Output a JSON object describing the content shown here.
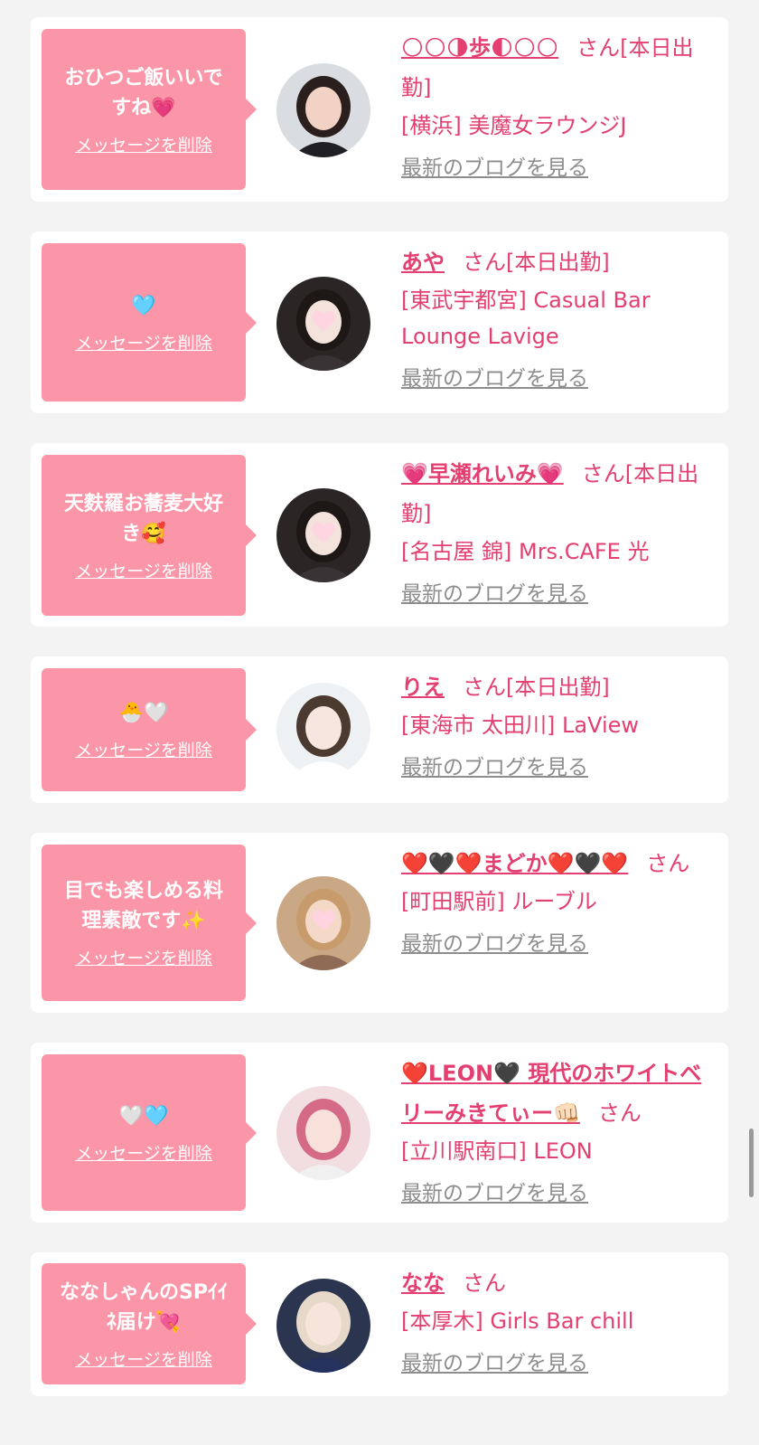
{
  "delete_label": "メッセージを削除",
  "blog_label": "最新のブログを見る",
  "colors": {
    "accent": "#e33f70",
    "bubble": "#fb96a8",
    "background": "#f3f3f3",
    "card": "#ffffff",
    "link_gray": "#8d8d8d"
  },
  "entries": [
    {
      "message": "おひつご飯いいで\nすね💗",
      "name": "🌕🌕🌗歩🌓🌕🌕",
      "suffix": "さん[本日出勤]",
      "shop": "[横浜] 美魔女ラウンジJ",
      "avatar_icon": "avatar-photo-suit"
    },
    {
      "message": "🩵",
      "name": "あや",
      "suffix": "さん[本日出勤]",
      "shop": "[東武宇都宮] Casual Bar Lounge Lavige",
      "avatar_icon": "avatar-photo-heart"
    },
    {
      "message": "天麩羅お蕎麦大好\nき🥰",
      "name": "💗早瀬れいみ💗",
      "suffix": "さん[本日出勤]",
      "shop": "[名古屋 錦] Mrs.CAFE 光",
      "avatar_icon": "avatar-photo-heart"
    },
    {
      "message": "🐣🤍",
      "name": "りえ",
      "suffix": "さん[本日出勤]",
      "shop": "[東海市 太田川] LaView",
      "avatar_icon": "avatar-photo-light"
    },
    {
      "message": "目でも楽しめる料\n理素敵です✨",
      "name": "❤️🖤❤️まどか❤️🖤❤️",
      "suffix": "さん",
      "shop": "[町田駅前] ルーブル",
      "avatar_icon": "avatar-photo-blonde"
    },
    {
      "message": "🤍🩵",
      "name": "❤️LEON🖤 現代のホワイトベリーみきてぃー👊🏻",
      "suffix": "さん",
      "shop": "[立川駅南口] LEON",
      "avatar_icon": "avatar-photo-pink"
    },
    {
      "message": "ななしゃんのSPｲｲ\nﾈ届け💘",
      "name": "なな",
      "suffix": "さん",
      "shop": "[本厚木] Girls Bar chill",
      "avatar_icon": "avatar-photo-blue"
    }
  ]
}
